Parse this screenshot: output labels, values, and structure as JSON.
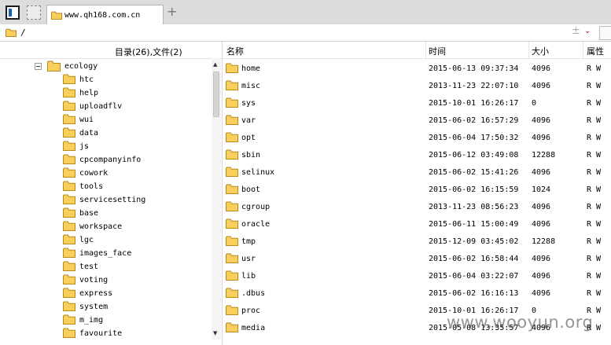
{
  "tab": {
    "title": "www.qh168.com.cn",
    "add": "+"
  },
  "address": {
    "path": "/",
    "plus": "±",
    "dropdown": "⌄"
  },
  "tree": {
    "header": "目录(26),文件(2)",
    "root": "ecology",
    "items": [
      "htc",
      "help",
      "uploadflv",
      "wui",
      "data",
      "js",
      "cpcompanyinfo",
      "cowork",
      "tools",
      "servicesetting",
      "base",
      "workspace",
      "lgc",
      "images_face",
      "test",
      "voting",
      "express",
      "system",
      "m_img",
      "favourite"
    ]
  },
  "list": {
    "columns": {
      "name": "名称",
      "time": "时间",
      "size": "大小",
      "attr": "属性"
    },
    "rows": [
      {
        "name": "home",
        "time": "2015-06-13 09:37:34",
        "size": "4096",
        "attr": "R W"
      },
      {
        "name": "misc",
        "time": "2013-11-23 22:07:10",
        "size": "4096",
        "attr": "R W"
      },
      {
        "name": "sys",
        "time": "2015-10-01 16:26:17",
        "size": "0",
        "attr": "R W"
      },
      {
        "name": "var",
        "time": "2015-06-02 16:57:29",
        "size": "4096",
        "attr": "R W"
      },
      {
        "name": "opt",
        "time": "2015-06-04 17:50:32",
        "size": "4096",
        "attr": "R W"
      },
      {
        "name": "sbin",
        "time": "2015-06-12 03:49:08",
        "size": "12288",
        "attr": "R W"
      },
      {
        "name": "selinux",
        "time": "2015-06-02 15:41:26",
        "size": "4096",
        "attr": "R W"
      },
      {
        "name": "boot",
        "time": "2015-06-02 16:15:59",
        "size": "1024",
        "attr": "R W"
      },
      {
        "name": "cgroup",
        "time": "2013-11-23 08:56:23",
        "size": "4096",
        "attr": "R W"
      },
      {
        "name": "oracle",
        "time": "2015-06-11 15:00:49",
        "size": "4096",
        "attr": "R W"
      },
      {
        "name": "tmp",
        "time": "2015-12-09 03:45:02",
        "size": "12288",
        "attr": "R W"
      },
      {
        "name": "usr",
        "time": "2015-06-02 16:58:44",
        "size": "4096",
        "attr": "R W"
      },
      {
        "name": "lib",
        "time": "2015-06-04 03:22:07",
        "size": "4096",
        "attr": "R W"
      },
      {
        "name": ".dbus",
        "time": "2015-06-02 16:16:13",
        "size": "4096",
        "attr": "R W"
      },
      {
        "name": "proc",
        "time": "2015-10-01 16:26:17",
        "size": "0",
        "attr": "R W"
      },
      {
        "name": "media",
        "time": "2015-05-08 13:35:57",
        "size": "4096",
        "attr": "R W"
      }
    ]
  },
  "watermark": "www.wooyun.org",
  "icons": {
    "folder": "folder-icon",
    "collapse": "collapse-icon",
    "panel": "panel-toggle-icon"
  },
  "colors": {
    "folder_fill": "#f7cf5a",
    "folder_stroke": "#b88a1b",
    "accent": "#1a5fb4"
  }
}
